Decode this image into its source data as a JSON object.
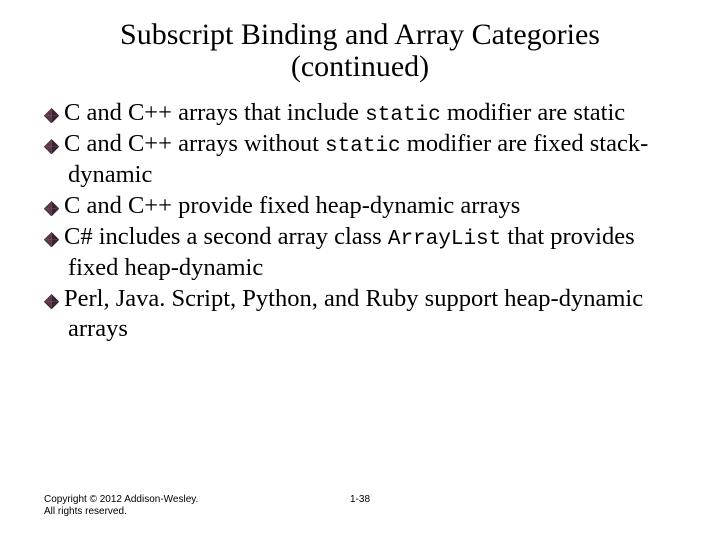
{
  "title_l1": "Subscript Binding and Array Categories",
  "title_l2": "(continued)",
  "bullets": [
    {
      "pre": "C and C++ arrays that include ",
      "code": "static",
      "post": " modifier are static"
    },
    {
      "pre": "C and C++ arrays without ",
      "code": "static",
      "post": " modifier are fixed stack-dynamic"
    },
    {
      "pre": "C and C++ provide fixed heap-dynamic arrays",
      "code": "",
      "post": ""
    },
    {
      "pre": "C# includes a second array class ",
      "code": "ArrayList",
      "post": " that provides fixed heap-dynamic"
    },
    {
      "pre": "Perl, Java. Script, Python, and Ruby support heap-dynamic arrays",
      "code": "",
      "post": ""
    }
  ],
  "footer": {
    "copyright": "Copyright © 2012 Addison-Wesley. All rights reserved.",
    "pagenum": "1-38"
  },
  "bullet_svg": "<svg width='15' height='15' viewBox='0 0 10 10'><path d='M5 0 L10 5 L5 10 L0 5 Z' fill='#5a3a4a'/><path d='M5 0 L10 5 L5 10 Z' fill='#3a2433'/><path d='M0 5 L5 10 L10 5' fill='none' stroke='#2a1825' stroke-width='0.4'/><path d='M5 0 L5 10 M0 5 L10 5' stroke='#7a5a6a' stroke-width='0.3'/></svg>"
}
